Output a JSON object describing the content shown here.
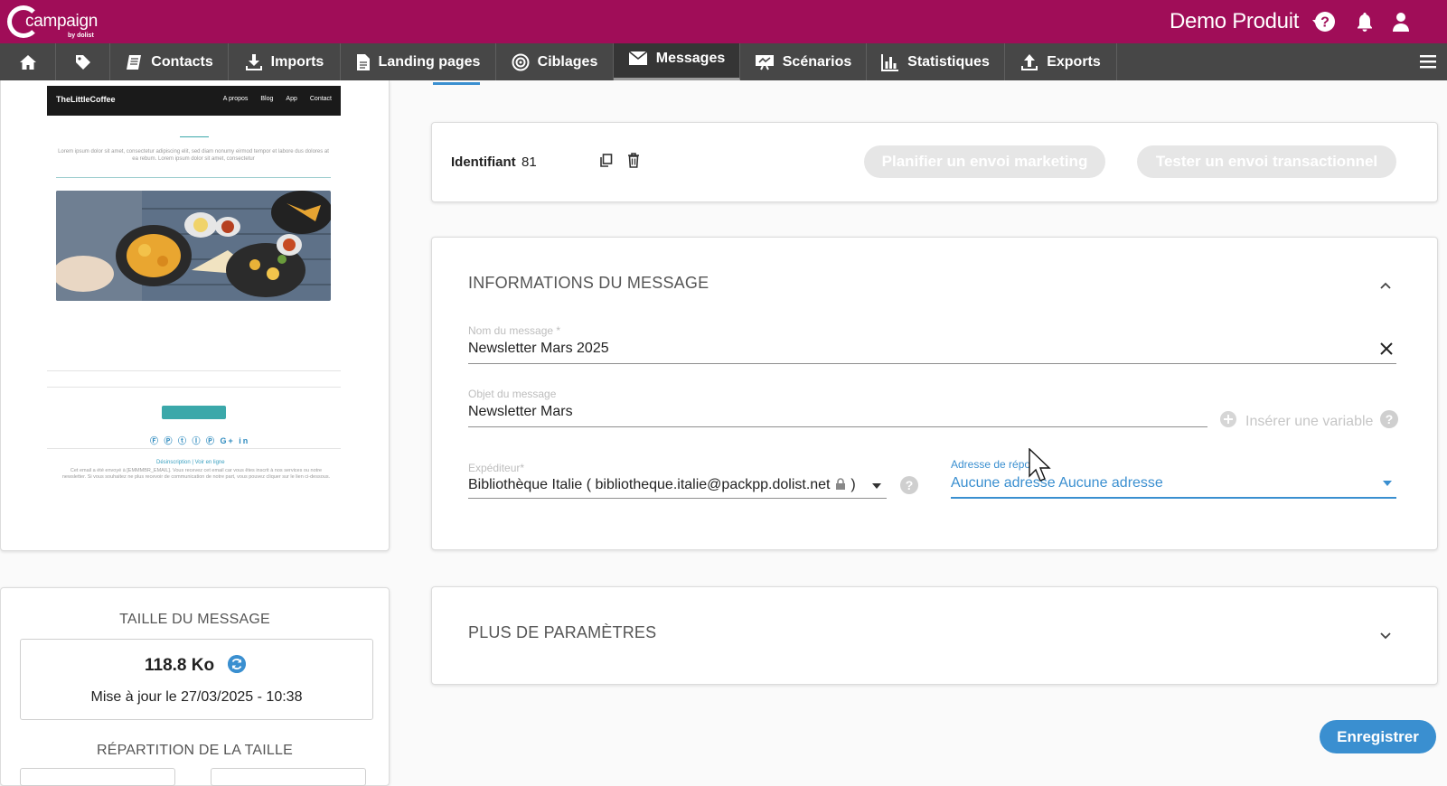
{
  "topbar": {
    "logo_word": "campaign",
    "logo_by": "by dolist",
    "account": "Demo Produit",
    "icons": [
      "help-icon",
      "bell-icon",
      "user-icon"
    ]
  },
  "nav": {
    "items": [
      {
        "label": "",
        "icon": "home-icon"
      },
      {
        "label": "",
        "icon": "tag-icon"
      },
      {
        "label": "Contacts",
        "icon": "contacts-book-icon"
      },
      {
        "label": "Imports",
        "icon": "download-icon"
      },
      {
        "label": "Landing pages",
        "icon": "document-icon"
      },
      {
        "label": "Ciblages",
        "icon": "target-icon"
      },
      {
        "label": "Messages",
        "icon": "envelope-icon",
        "active": true
      },
      {
        "label": "Scénarios",
        "icon": "scenario-icon"
      },
      {
        "label": "Statistiques",
        "icon": "bar-chart-icon"
      },
      {
        "label": "Exports",
        "icon": "upload-icon"
      }
    ]
  },
  "preview": {
    "brand": "TheLittleCoffee",
    "links": [
      "A propos",
      "Blog",
      "App",
      "Contact"
    ],
    "intro": "Lorem ipsum dolor sit amet, consectetur adipiscing elit, sed diam nonumy eirmod tempor et labore dus dolores at ea rebum. Lorem ipsum dolor sit amet, consectetur",
    "social": "Ⓕ Ⓟ ⓣ Ⓘ Ⓟ G+ in",
    "footer_links": "Désinscription  |  Voir en ligne",
    "footer_text": "Cet email a été envoyé à [EMMMBR_EMAIL]. Vous recevez cet email car vous êtes inscrit à nos services ou notre newsletter. Si vous souhaitez ne plus recevoir de communication de notre part, vous pouvez cliquer sur le lien ci-dessous."
  },
  "size": {
    "title": "TAILLE DU MESSAGE",
    "value": "118.8 Ko",
    "updated": "Mise à jour le 27/03/2025 - 10:38",
    "repartition_title": "RÉPARTITION DE LA TAILLE"
  },
  "identifier": {
    "label": "Identifiant",
    "value": "81",
    "plan_button": "Planifier un envoi marketing",
    "test_button": "Tester un envoi transactionnel"
  },
  "info": {
    "title": "INFORMATIONS DU MESSAGE",
    "name_label": "Nom du message *",
    "name_value": "Newsletter Mars 2025",
    "subject_label": "Objet du message",
    "subject_value": "Newsletter Mars",
    "insert_variable": "Insérer une variable",
    "sender_label": "Expéditeur*",
    "sender_value": "Bibliothèque Italie ( bibliotheque.italie@packpp.dolist.net",
    "sender_close": ")",
    "reply_label": "Adresse de répo",
    "reply_value": "Aucune adresse Aucune adresse"
  },
  "more": {
    "title": "PLUS DE PARAMÈTRES"
  },
  "save_button": "Enregistrer",
  "colors": {
    "brand": "#a00d58",
    "nav": "#474747",
    "accent": "#3a8fd0"
  }
}
